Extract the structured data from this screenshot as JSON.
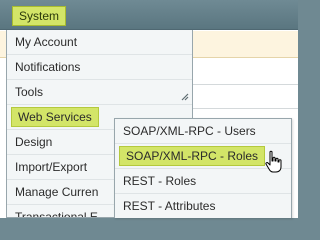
{
  "nav": {
    "system_label": "System"
  },
  "menu": {
    "items": [
      {
        "label": "My Account"
      },
      {
        "label": "Notifications"
      },
      {
        "label": "Tools"
      },
      {
        "label": "Web Services"
      },
      {
        "label": "Design"
      },
      {
        "label": "Import/Export"
      },
      {
        "label": "Manage Curren"
      },
      {
        "label": "Transactional E"
      }
    ],
    "highlight_color": "#d3e568"
  },
  "submenu": {
    "items": [
      {
        "label": "SOAP/XML-RPC - Users"
      },
      {
        "label": "SOAP/XML-RPC - Roles"
      },
      {
        "label": "REST - Roles"
      },
      {
        "label": "REST - Attributes"
      }
    ]
  },
  "icons": {
    "resize": "resize-grip-icon",
    "cursor": "hand-pointer-icon"
  }
}
